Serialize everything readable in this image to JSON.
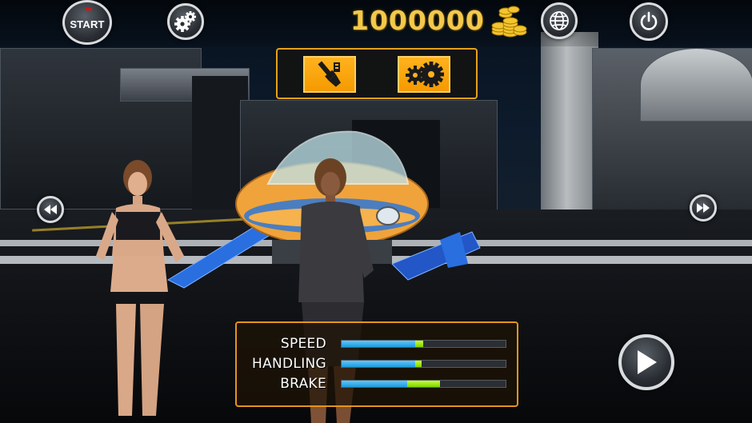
{
  "topbar": {
    "start_label": "START",
    "coins": "1000000"
  },
  "icons": {
    "start": "start-icon",
    "settings": "gears-icon",
    "coins": "gold-coins-icon",
    "language": "globe-icon",
    "power": "power-icon",
    "paint": "paint-brush-icon",
    "tuning": "gears-icon",
    "prev": "rewind-icon",
    "next": "fast-forward-icon",
    "play": "play-icon"
  },
  "stats": [
    {
      "label": "SPEED",
      "base": 0.45,
      "upgrade": 0.05
    },
    {
      "label": "HANDLING",
      "base": 0.45,
      "upgrade": 0.04
    },
    {
      "label": "BRAKE",
      "base": 0.4,
      "upgrade": 0.2
    }
  ],
  "colors": {
    "accent": "#e59519",
    "coin_text": "#f2c94c",
    "stat_base": "#1f9ad9",
    "stat_upgrade": "#7fd400"
  }
}
